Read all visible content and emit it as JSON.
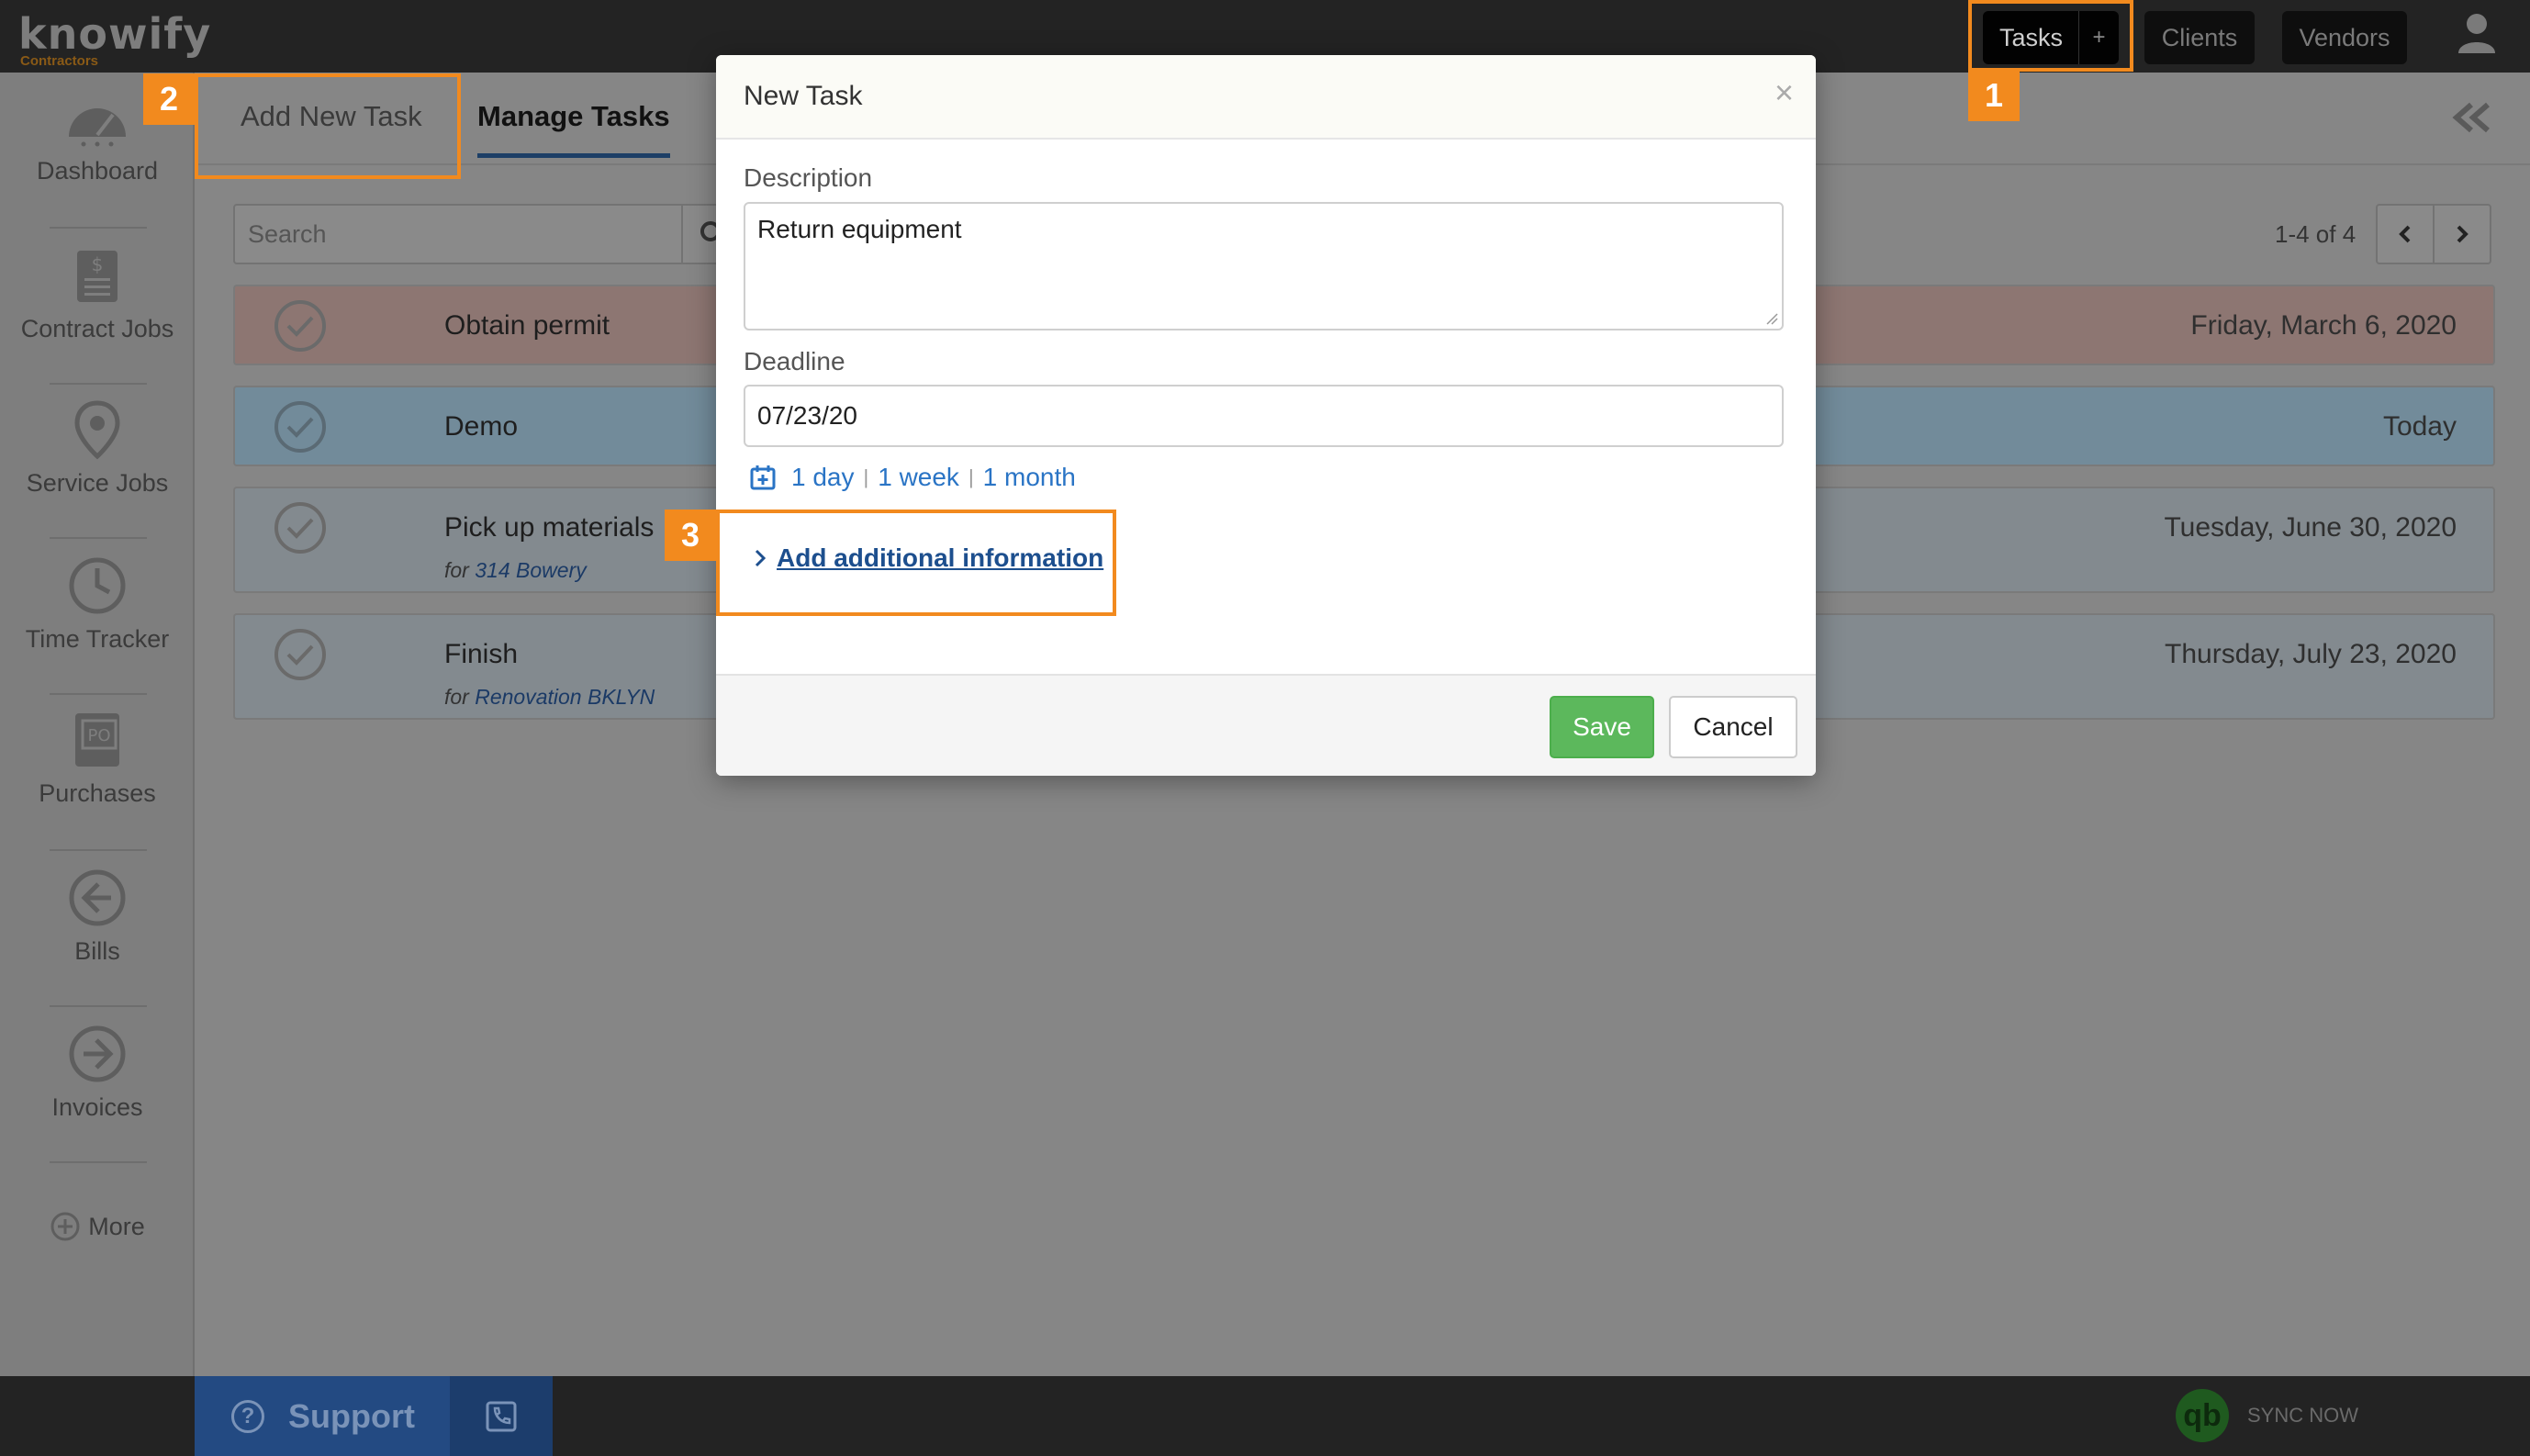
{
  "app": {
    "brand": "knowify",
    "brand_sub": "Contractors"
  },
  "topnav": {
    "tasks_label": "Tasks",
    "tasks_plus": "+",
    "clients_label": "Clients",
    "vendors_label": "Vendors"
  },
  "sidebar": {
    "items": [
      {
        "label": "Dashboard",
        "icon": "gauge-icon"
      },
      {
        "label": "Contract Jobs",
        "icon": "document-dollar-icon"
      },
      {
        "label": "Service Jobs",
        "icon": "map-pin-icon"
      },
      {
        "label": "Time Tracker",
        "icon": "clock-icon"
      },
      {
        "label": "Purchases",
        "icon": "po-document-icon"
      },
      {
        "label": "Bills",
        "icon": "arrow-left-circle-icon"
      },
      {
        "label": "Invoices",
        "icon": "arrow-right-circle-icon"
      }
    ],
    "more_label": "More"
  },
  "tabs": {
    "add_label": "Add New Task",
    "manage_label": "Manage Tasks"
  },
  "list": {
    "search_placeholder": "Search",
    "pager_text": "1-4 of 4",
    "rows": [
      {
        "name": "Obtain permit",
        "sub_prefix": "",
        "sub_link": "",
        "date": "Friday, March 6, 2020",
        "color": "#8d7672"
      },
      {
        "name": "Demo",
        "sub_prefix": "",
        "sub_link": "",
        "date": "Today",
        "color": "#728b9a"
      },
      {
        "name": "Pick up materials",
        "sub_prefix": "for",
        "sub_link": "314 Bowery",
        "date": "Tuesday, June 30, 2020",
        "color": "#838a8f"
      },
      {
        "name": "Finish",
        "sub_prefix": "for",
        "sub_link": "Renovation BKLYN",
        "date": "Thursday, July 23, 2020",
        "color": "#838a8f"
      }
    ]
  },
  "modal": {
    "title": "New Task",
    "close": "×",
    "description_label": "Description",
    "description_value": "Return equipment",
    "deadline_label": "Deadline",
    "deadline_value": "07/23/20",
    "quick_1day": "1 day",
    "quick_1week": "1 week",
    "quick_1month": "1 month",
    "more_info_label": "Add additional information",
    "save_label": "Save",
    "cancel_label": "Cancel"
  },
  "callouts": {
    "one": "1",
    "two": "2",
    "three": "3",
    "color": "#f28a1e"
  },
  "footer": {
    "support_label": "Support",
    "support_q": "?",
    "qb_label": "qb",
    "sync_label": "SYNC NOW"
  }
}
